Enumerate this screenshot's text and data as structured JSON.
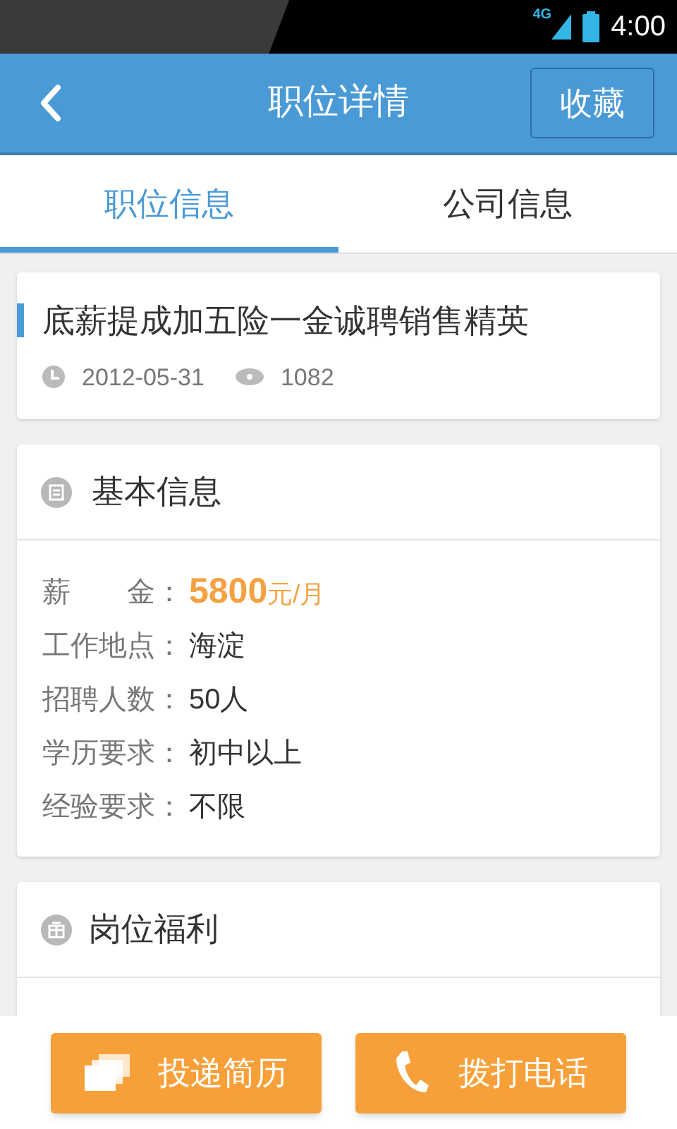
{
  "status_bar": {
    "network": "4G",
    "time": "4:00"
  },
  "header": {
    "title": "职位详情",
    "action": "收藏"
  },
  "tabs": [
    {
      "label": "职位信息",
      "selected": true
    },
    {
      "label": "公司信息",
      "selected": false
    }
  ],
  "job": {
    "title": "底薪提成加五险一金诚聘销售精英",
    "date": "2012-05-31",
    "views": "1082"
  },
  "basic_info": {
    "title": "基本信息",
    "rows": [
      {
        "kind": "salary",
        "label": "薪　　金：",
        "value": "5800",
        "unit": "元/月"
      },
      {
        "kind": "text",
        "label": "工作地点：",
        "value": "海淀"
      },
      {
        "kind": "text",
        "label": "招聘人数：",
        "value": "50人"
      },
      {
        "kind": "text",
        "label": "学历要求：",
        "value": "初中以上"
      },
      {
        "kind": "text",
        "label": "经验要求：",
        "value": "不限"
      }
    ]
  },
  "benefits": {
    "title": "岗位福利"
  },
  "actions": [
    {
      "kind": "resume",
      "label": "投递简历"
    },
    {
      "kind": "call",
      "label": "拨打电话"
    }
  ]
}
